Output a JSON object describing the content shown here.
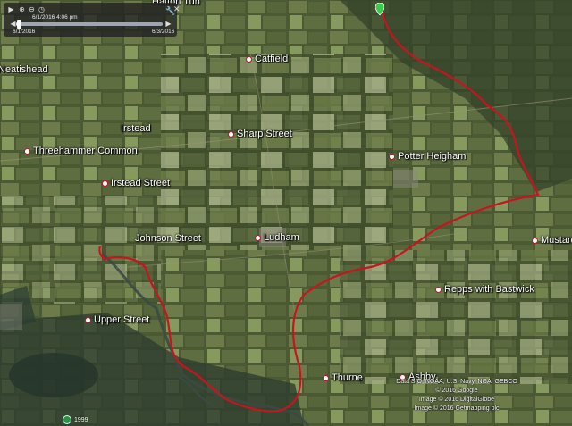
{
  "timeslider": {
    "current_time": "6/1/2016   4:06 pm",
    "start_date": "6/1/2016",
    "end_date": "6/3/2016",
    "progress": 0.02
  },
  "places": [
    {
      "id": "heatishead",
      "label": "Neatishead"
    },
    {
      "id": "catfield",
      "label": "Catfield"
    },
    {
      "id": "irstead",
      "label": "Irstead"
    },
    {
      "id": "sharp-street",
      "label": "Sharp Street"
    },
    {
      "id": "threehammer-common",
      "label": "Threehammer Common"
    },
    {
      "id": "potter-heigham",
      "label": "Potter Heigham"
    },
    {
      "id": "irstead-street",
      "label": "Irstead Street"
    },
    {
      "id": "johnson-street",
      "label": "Johnson Street"
    },
    {
      "id": "ludham",
      "label": "Ludham"
    },
    {
      "id": "mustard",
      "label": "Mustard"
    },
    {
      "id": "repps-with-bastwick",
      "label": "Repps with Bastwick"
    },
    {
      "id": "upper-street",
      "label": "Upper Street"
    },
    {
      "id": "thurne",
      "label": "Thurne"
    },
    {
      "id": "ashby",
      "label": "Ashby"
    }
  ],
  "top_partial_label": "Hatton Tun",
  "imagery_year": "1999",
  "credits": [
    "Data SIO, NOAA, U.S. Navy, NGA, GEBCO",
    "© 2016 Google",
    "Image © 2016 DigitalGlobe",
    "Image © 2016 Getmapping plc"
  ],
  "colors": {
    "track": "#c8141e",
    "river": "#3a4a44",
    "field_dark": "#3f4d2c",
    "field_light": "#8fa06a"
  },
  "icons": {
    "play": "play-icon",
    "zoom_in": "zoom-in-icon",
    "zoom_out": "zoom-out-icon",
    "settings": "wrench-icon",
    "close": "close-icon",
    "start_marker": "map-pin-icon"
  }
}
